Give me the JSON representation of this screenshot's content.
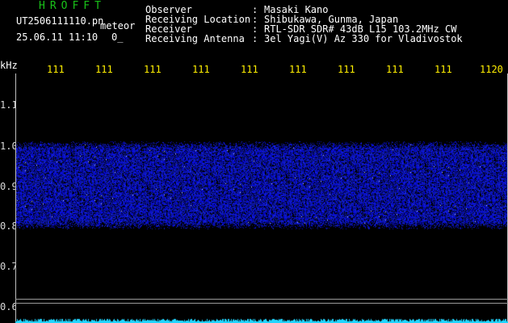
{
  "header": {
    "brand": "HROFFT",
    "filename": "UT2506111110.pn",
    "type": "meteor",
    "datetime": "25.06.11 11:10",
    "count": "0_",
    "info": [
      {
        "key": "Observer",
        "value": "Masaki Kano"
      },
      {
        "key": "Receiving Location",
        "value": "Shibukawa, Gunma, Japan"
      },
      {
        "key": "Receiver",
        "value": "RTL-SDR SDR# 43dB L15 103.2MHz CW"
      },
      {
        "key": "Receiving Antenna",
        "value": "3el Yagi(V) Az 330 for Vladivostok"
      }
    ]
  },
  "axes": {
    "unit": "kHz",
    "x_ticks": [
      "111",
      "111",
      "111",
      "111",
      "111",
      "111",
      "111",
      "111",
      "111",
      "1120"
    ],
    "y_ticks": [
      "1.1",
      "1.0",
      "0.9",
      "0.8",
      "0.7",
      "0.6"
    ]
  },
  "colors": {
    "noise": "#1a2bd8",
    "baseline": "#21d6ff",
    "tick_text": "#ffee00",
    "brand": "#19c319"
  },
  "band": {
    "low_khz": 0.8,
    "high_khz": 1.0
  }
}
